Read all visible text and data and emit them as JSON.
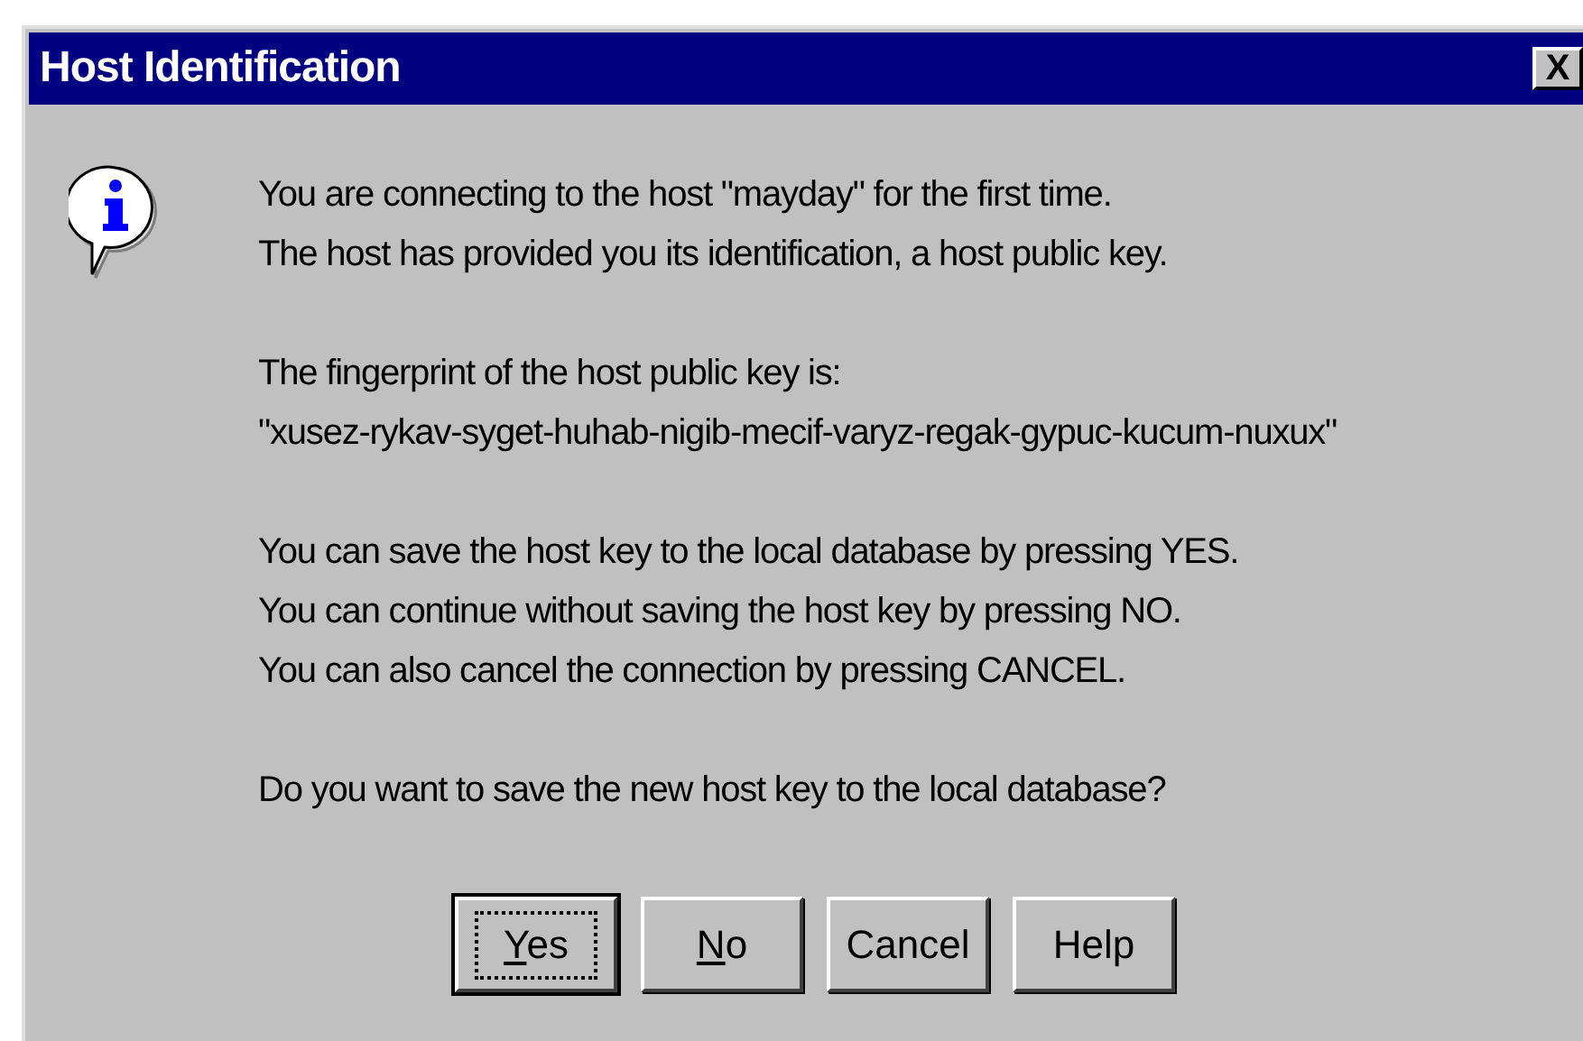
{
  "window": {
    "title": "Host Identification",
    "close": "X"
  },
  "paragraphs": [
    [
      "You are connecting to the host \"mayday\" for the first time.",
      "The host has provided you its identification, a host public key."
    ],
    [
      "The fingerprint of the host public key is:",
      "\"xusez-rykav-syget-huhab-nigib-mecif-varyz-regak-gypuc-kucum-nuxux\""
    ],
    [
      "You can save the host key to the local database by pressing YES.",
      "You can continue without saving the host key by pressing NO.",
      "You can also cancel the connection by pressing CANCEL."
    ],
    [
      "Do you want to save the new host key to the local database?"
    ]
  ],
  "buttons": [
    {
      "label": "Yes",
      "mnemonic": true,
      "default": true
    },
    {
      "label": "No",
      "mnemonic": true,
      "default": false
    },
    {
      "label": "Cancel",
      "mnemonic": false,
      "default": false
    },
    {
      "label": "Help",
      "mnemonic": false,
      "default": false
    }
  ]
}
